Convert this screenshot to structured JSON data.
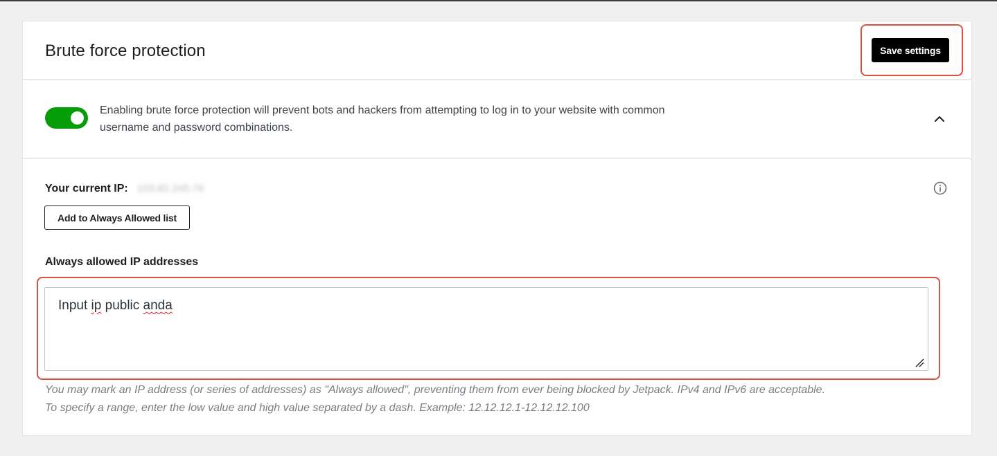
{
  "header": {
    "title": "Brute force protection",
    "save_label": "Save settings"
  },
  "toggle_section": {
    "enabled": true,
    "description_line1": "Enabling brute force protection will prevent bots and hackers from attempting to log in to your website with common",
    "description_line2": "username and password combinations.",
    "chevron_icon": "chevron-up-icon"
  },
  "current_ip": {
    "label": "Your current IP:",
    "value": "103.82.245.79",
    "add_button_label": "Add to Always Allowed list",
    "info_icon": "info-icon"
  },
  "allowed_ips": {
    "label": "Always allowed IP addresses",
    "value_word1": "Input ",
    "value_word2": "ip",
    "value_word3": " public ",
    "value_word4": "anda",
    "help_line1": "You may mark an IP address (or series of addresses) as \"Always allowed\", preventing them from ever being blocked by Jetpack. IPv4 and IPv6 are acceptable.",
    "help_line2": "To specify a range, enter the low value and high value separated by a dash. Example: 12.12.12.1-12.12.12.100"
  },
  "colors": {
    "toggle_on": "#069e08",
    "highlight": "#d9503f",
    "primary_button": "#000000"
  }
}
